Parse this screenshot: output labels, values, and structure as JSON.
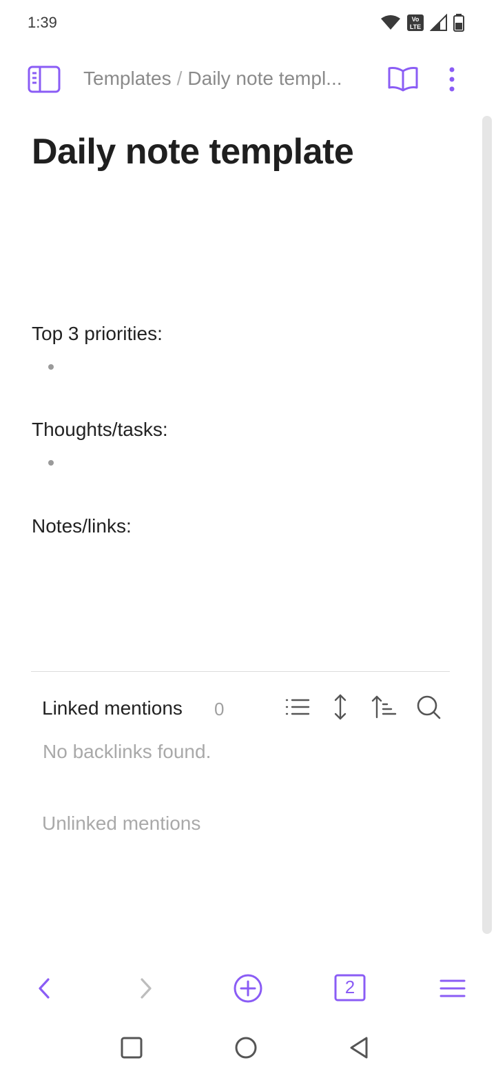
{
  "status": {
    "time": "1:39",
    "lte_label": "LTE",
    "vo_label": "Vo"
  },
  "header": {
    "breadcrumb_parent": "Templates",
    "breadcrumb_separator": "/",
    "breadcrumb_current": "Daily note templ..."
  },
  "page": {
    "title": "Daily note template",
    "sections": [
      {
        "label": "Top 3 priorities:"
      },
      {
        "label": "Thoughts/tasks:"
      },
      {
        "label": "Notes/links:"
      }
    ]
  },
  "backlinks": {
    "linked_title": "Linked mentions",
    "linked_count": "0",
    "empty_message": "No backlinks found.",
    "unlinked_title": "Unlinked mentions"
  },
  "toolbar": {
    "tab_count": "2"
  },
  "colors": {
    "accent": "#8a5cf5",
    "text": "#222222",
    "muted": "#a9a9a9"
  }
}
